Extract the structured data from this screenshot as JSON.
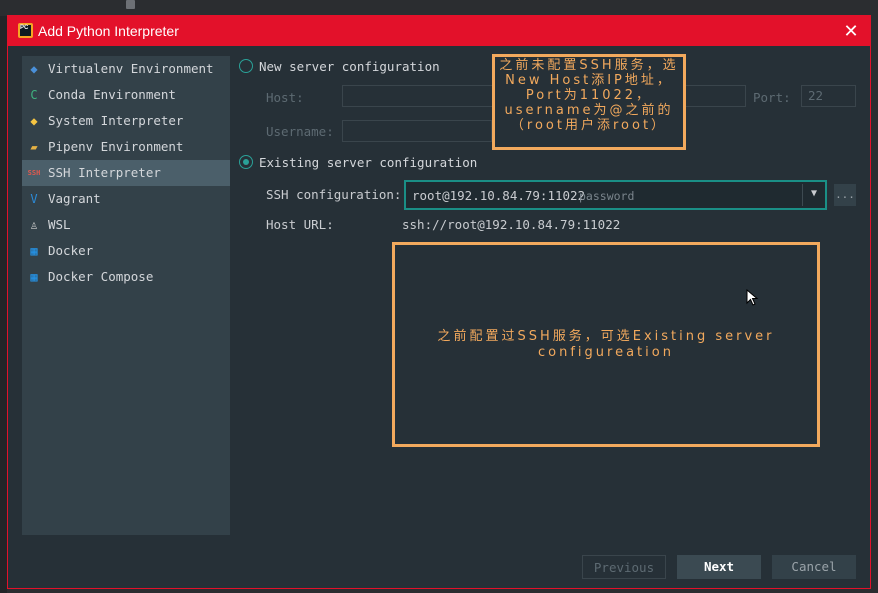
{
  "window": {
    "title": "Add Python Interpreter",
    "close_glyph": "✕"
  },
  "sidebar": {
    "items": [
      {
        "label": "Virtualenv Environment",
        "icon": "virtualenv-icon",
        "glyph": "◆",
        "color": "#4a90d9"
      },
      {
        "label": "Conda Environment",
        "icon": "conda-icon",
        "glyph": "C",
        "color": "#3fb27f"
      },
      {
        "label": "System Interpreter",
        "icon": "python-icon",
        "glyph": "◆",
        "color": "#f5c542"
      },
      {
        "label": "Pipenv Environment",
        "icon": "pipenv-icon",
        "glyph": "▰",
        "color": "#e5b143"
      },
      {
        "label": "SSH Interpreter",
        "icon": "ssh-icon",
        "glyph": "SSH",
        "color": "#e05a4f",
        "selected": true
      },
      {
        "label": "Vagrant",
        "icon": "vagrant-icon",
        "glyph": "V",
        "color": "#2c8bd8"
      },
      {
        "label": "WSL",
        "icon": "linux-icon",
        "glyph": "♙",
        "color": "#d0d0d0"
      },
      {
        "label": "Docker",
        "icon": "docker-icon",
        "glyph": "▦",
        "color": "#2496ed"
      },
      {
        "label": "Docker Compose",
        "icon": "docker-compose-icon",
        "glyph": "▦",
        "color": "#2496ed"
      }
    ]
  },
  "new_server": {
    "label": "New server configuration",
    "host_label": "Host:",
    "host_value": "",
    "port_label": "Port:",
    "port_value": "22",
    "username_label": "Username:",
    "username_value": ""
  },
  "existing_server": {
    "label": "Existing server configuration",
    "ssh_config_label": "SSH configuration:",
    "ssh_config_value": "root@192.10.84.79:11022",
    "ssh_config_hint": "password",
    "more_button": "...",
    "host_url_label": "Host URL:",
    "host_url_value": "ssh://root@192.10.84.79:11022"
  },
  "annotations": {
    "note_new": "之前未配置SSH服务，选New Host添IP地址，Port为11022，username为@之前的（root用户添root）",
    "note_existing": "之前配置过SSH服务，可选Existing server configureation"
  },
  "buttons": {
    "previous": "Previous",
    "next": "Next",
    "cancel": "Cancel"
  },
  "colors": {
    "accent": "#2aa198",
    "titlebar": "#e3112a",
    "annotation": "#f2a95d"
  }
}
